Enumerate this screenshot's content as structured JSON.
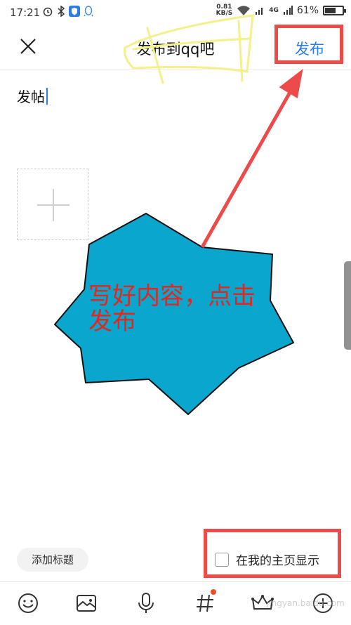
{
  "status_bar": {
    "time": "17:21",
    "net_speed_value": "0.81",
    "net_speed_unit": "KB/S",
    "network_type": "4G",
    "battery": "61%",
    "battery_level": 0.61
  },
  "header": {
    "title": "发布到qq吧",
    "publish_label": "发布"
  },
  "editor": {
    "text_value": "发帖"
  },
  "actions": {
    "add_title_label": "添加标题",
    "show_on_home_label": "在我的主页显示",
    "show_on_home_checked": false
  },
  "toolbar": {
    "items": [
      "emoji-icon",
      "image-icon",
      "mic-icon",
      "hashtag-icon",
      "crown-icon",
      "plus-icon"
    ],
    "hashtag_has_badge": true
  },
  "annotation": {
    "callout_text": "写好内容，点击发布",
    "colors": {
      "arrow": "#ed4a4a",
      "starburst": "#0aa6cd",
      "callout_text": "#e3261e",
      "scribble": "#f4f08a"
    }
  },
  "colors": {
    "accent": "#2b7de9",
    "badge": "#f04e23"
  },
  "watermark": "jingyan.baidu.com"
}
